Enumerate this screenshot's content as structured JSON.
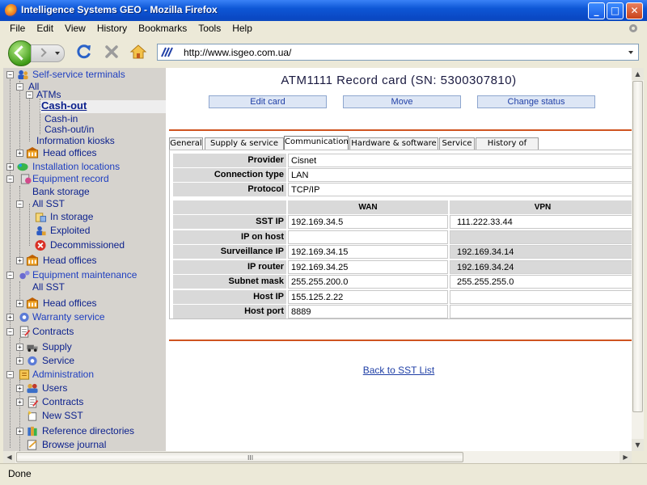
{
  "window": {
    "title": "Intelligence Systems GEO - Mozilla Firefox",
    "minimize": "_",
    "maximize": "□",
    "close": "✕"
  },
  "menu": [
    "File",
    "Edit",
    "View",
    "History",
    "Bookmarks",
    "Tools",
    "Help"
  ],
  "address": {
    "url": "http://www.isgeo.com.ua/"
  },
  "sidebar": [
    {
      "label": "Self-service terminals",
      "icon": "people-icon",
      "color": "blue"
    },
    {
      "label": "All",
      "color": "dark"
    },
    {
      "label": "ATMs",
      "color": "dark"
    },
    {
      "label": "Cash-out",
      "color": "sel"
    },
    {
      "label": "Cash-in",
      "color": "dark"
    },
    {
      "label": "Cash-out/in",
      "color": "dark"
    },
    {
      "label": "Information kiosks",
      "color": "dark"
    },
    {
      "label": "Head offices",
      "icon": "building-icon",
      "color": "dark"
    },
    {
      "label": "Installation locations",
      "icon": "map-icon",
      "color": "blue"
    },
    {
      "label": "Equipment record",
      "icon": "equipment-icon",
      "color": "blue"
    },
    {
      "label": "Bank storage",
      "color": "dark"
    },
    {
      "label": "All SST",
      "color": "dark"
    },
    {
      "label": "In storage",
      "icon": "storage-icon",
      "color": "dark"
    },
    {
      "label": "Exploited",
      "icon": "user-icon",
      "color": "dark"
    },
    {
      "label": "Decommissioned",
      "icon": "delete-icon",
      "color": "dark"
    },
    {
      "label": "Head offices",
      "icon": "building-icon",
      "color": "dark"
    },
    {
      "label": "Equipment maintenance",
      "icon": "gears-icon",
      "color": "blue"
    },
    {
      "label": "All SST",
      "color": "dark"
    },
    {
      "label": "Head offices",
      "icon": "building-icon",
      "color": "dark"
    },
    {
      "label": "Warranty service",
      "icon": "gear-icon",
      "color": "blue"
    },
    {
      "label": "Contracts",
      "icon": "contract-icon",
      "color": "dark"
    },
    {
      "label": "Supply",
      "icon": "truck-icon",
      "color": "dark"
    },
    {
      "label": "Service",
      "icon": "gear-icon",
      "color": "dark"
    },
    {
      "label": "Administration",
      "icon": "admin-icon",
      "color": "blue"
    },
    {
      "label": "Users",
      "icon": "users-icon",
      "color": "dark"
    },
    {
      "label": "Contracts",
      "icon": "contract-icon",
      "color": "dark"
    },
    {
      "label": "New SST",
      "icon": "new-icon",
      "color": "dark"
    },
    {
      "label": "Reference directories",
      "icon": "books-icon",
      "color": "dark"
    },
    {
      "label": "Browse journal",
      "icon": "journal-icon",
      "color": "dark"
    }
  ],
  "record": {
    "title": "ATM1111 Record card (SN: 5300307810)",
    "buttons": {
      "edit": "Edit card",
      "move": "Move",
      "status": "Change status"
    },
    "tabs": [
      "General",
      "Supply & service",
      "Communication",
      "Hardware & software",
      "Service",
      "History of works"
    ],
    "active_tab": "Communication",
    "provider_label": "Provider",
    "provider": "Cisnet",
    "conn_type_label": "Connection type",
    "conn_type": "LAN",
    "protocol_label": "Protocol",
    "protocol": "TCP/IP",
    "col_wan": "WAN",
    "col_vpn": "VPN",
    "rows": [
      {
        "label": "SST IP",
        "wan": "192.169.34.5",
        "vpn": "111.222.33.44"
      },
      {
        "label": "IP on host",
        "wan": "",
        "vpn": ""
      },
      {
        "label": "Surveillance IP",
        "wan": "192.169.34.15",
        "vpn": "192.169.34.14"
      },
      {
        "label": "IP router",
        "wan": "192.169.34.25",
        "vpn": "192.169.34.24"
      },
      {
        "label": "Subnet mask",
        "wan": "255.255.200.0",
        "vpn": "255.255.255.0"
      },
      {
        "label": "Host IP",
        "wan": "155.125.2.22",
        "vpn": ""
      },
      {
        "label": "Host port",
        "wan": "8889",
        "vpn": ""
      }
    ],
    "back_link": "Back to SST List"
  },
  "status": {
    "text": "Done"
  },
  "scroll_grip": "III",
  "colors": {
    "title_bar": "#0a48c4",
    "accent_line": "#cf5420",
    "link": "#1f3fa6",
    "sidebar_bg": "#d6d3ce"
  }
}
